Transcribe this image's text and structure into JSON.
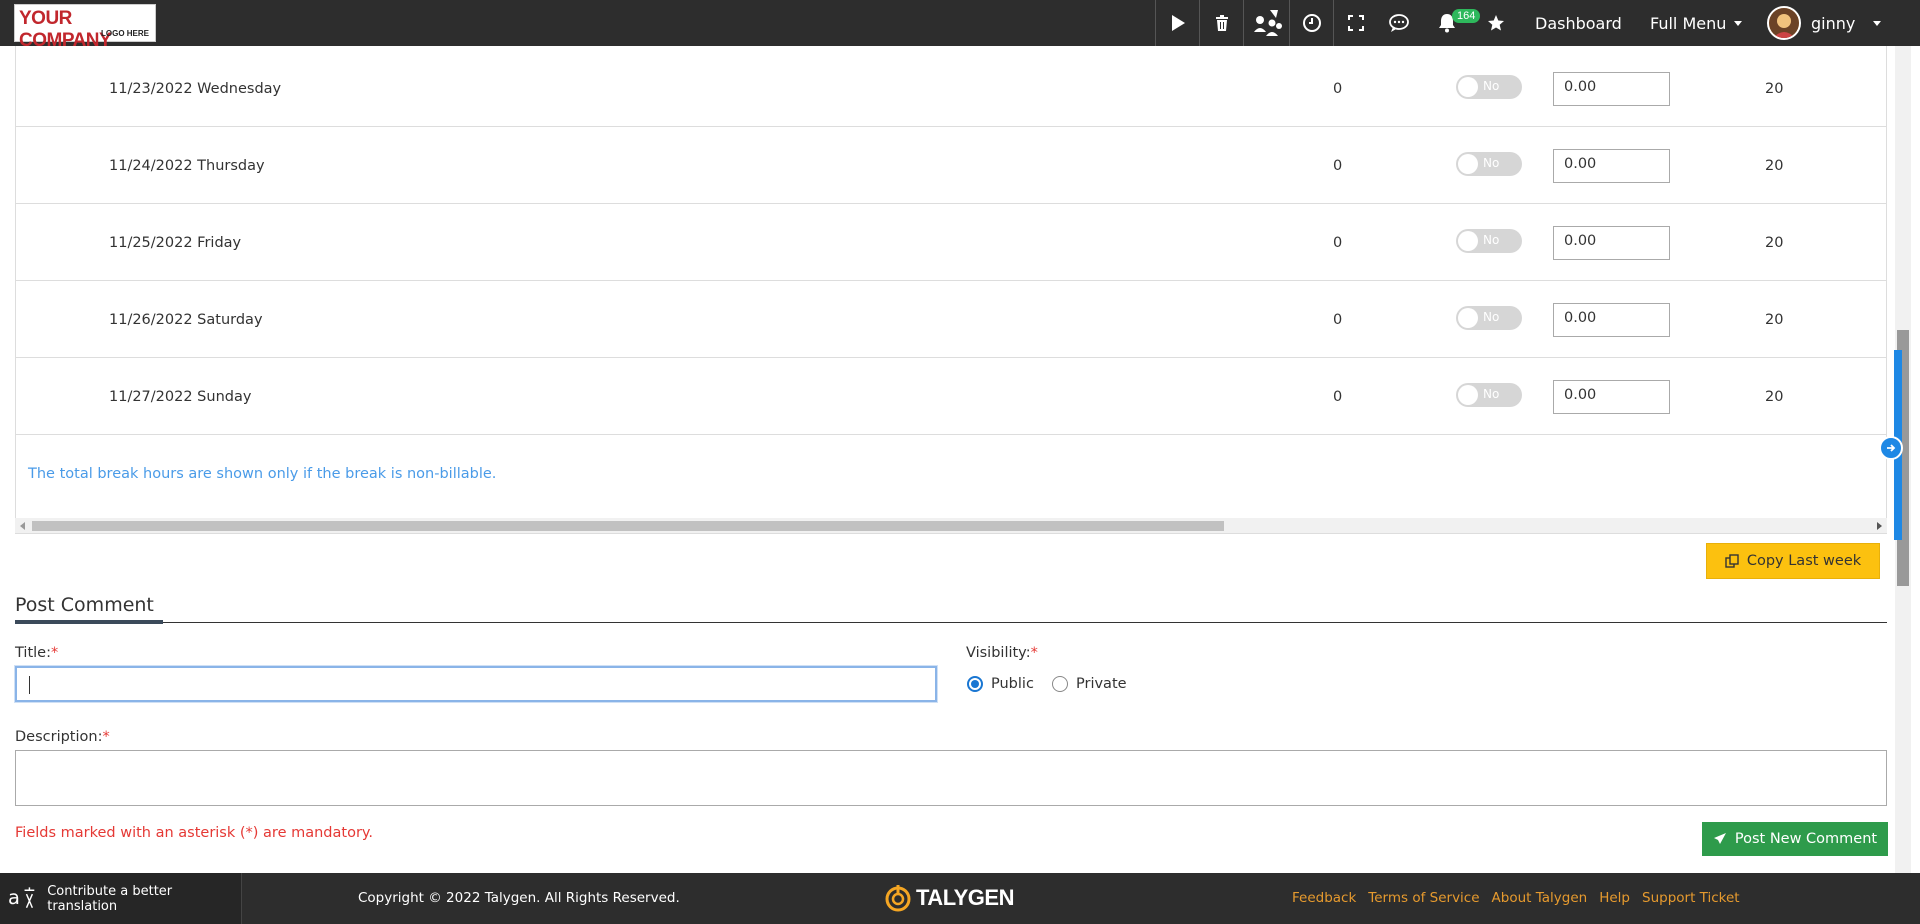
{
  "header": {
    "logo_line1": "YOUR COMPANY",
    "logo_line2": "LOGO HERE",
    "notification_count": "164",
    "dashboard_label": "Dashboard",
    "full_menu_label": "Full Menu",
    "user_name": "ginny"
  },
  "timesheet_rows": [
    {
      "date": "11/23/2022 Wednesday",
      "hours": "0",
      "toggle": "No",
      "input": "0.00",
      "value": "20"
    },
    {
      "date": "11/24/2022 Thursday",
      "hours": "0",
      "toggle": "No",
      "input": "0.00",
      "value": "20"
    },
    {
      "date": "11/25/2022 Friday",
      "hours": "0",
      "toggle": "No",
      "input": "0.00",
      "value": "20"
    },
    {
      "date": "11/26/2022 Saturday",
      "hours": "0",
      "toggle": "No",
      "input": "0.00",
      "value": "20"
    },
    {
      "date": "11/27/2022 Sunday",
      "hours": "0",
      "toggle": "No",
      "input": "0.00",
      "value": "20"
    }
  ],
  "note": "The total break hours are shown only if the break is non-billable.",
  "copy_last_week_label": "Copy Last week",
  "post_comment": {
    "section_title": "Post Comment",
    "title_label": "Title:",
    "visibility_label": "Visibility:",
    "visibility_options": [
      "Public",
      "Private"
    ],
    "visibility_selected": "Public",
    "description_label": "Description:",
    "required_mark": "*",
    "mandatory_note": "Fields marked with an asterisk (*) are mandatory.",
    "post_button_label": "Post New Comment"
  },
  "footer": {
    "contribute_label": "Contribute a better translation",
    "copyright": "Copyright © 2022 Talygen. All Rights Reserved.",
    "brand": "TALYGEN",
    "links": [
      "Feedback",
      "Terms of Service",
      "About Talygen",
      "Help",
      "Support Ticket"
    ]
  },
  "colors": {
    "topbar": "#2d2d2d",
    "accent_yellow": "#fcc10f",
    "accent_green": "#2e9b4b",
    "note_blue": "#4a9be8",
    "footer_link": "#e69a2e",
    "required_red": "#e53935"
  }
}
